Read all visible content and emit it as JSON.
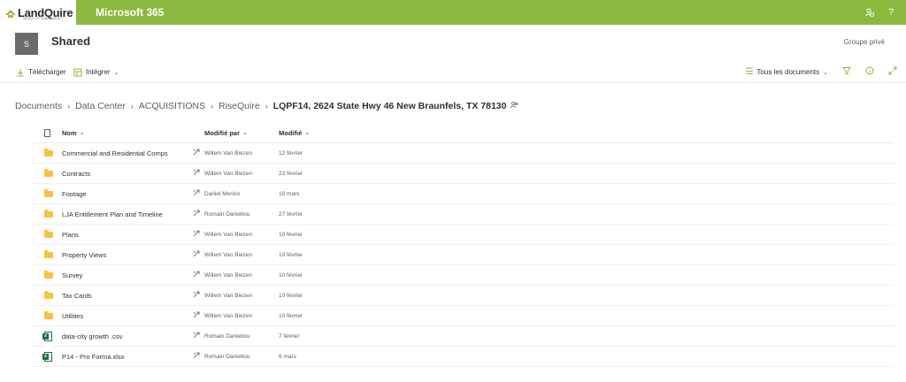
{
  "suitebar": {
    "logo_text": "LandQuire",
    "logo_tagline": "WORLD OF SUBDIVISION",
    "app_title": "Microsoft 365",
    "icons": [
      "people-settings-icon",
      "help-icon"
    ]
  },
  "site": {
    "avatar_letter": "S",
    "title": "Shared",
    "privacy": "Groupe privé"
  },
  "commands": {
    "download_label": "Télécharger",
    "integrate_label": "Intégrer",
    "view_label": "Tous les documents"
  },
  "breadcrumb": {
    "items": [
      "Documents",
      "Data Center",
      "ACQUISITIONS",
      "RiseQuire"
    ],
    "current": "LQPF14, 2624 State Hwy 46 New Braunfels, TX 78130"
  },
  "columns": {
    "name": "Nom",
    "modified_by": "Modifié par",
    "modified": "Modifié"
  },
  "files": [
    {
      "type": "folder",
      "name": "Commercial and Residential Comps",
      "modified_by": "Willem Van Biezen",
      "modified": "12 février"
    },
    {
      "type": "folder",
      "name": "Contracts",
      "modified_by": "Willem Van Biezen",
      "modified": "23 février"
    },
    {
      "type": "folder",
      "name": "Footage",
      "modified_by": "Daniel Merino",
      "modified": "10 mars"
    },
    {
      "type": "folder",
      "name": "LJA Entitlement Plan and Timeline",
      "modified_by": "Romain Daniellou",
      "modified": "27 février"
    },
    {
      "type": "folder",
      "name": "Plans",
      "modified_by": "Willem Van Biezen",
      "modified": "10 février"
    },
    {
      "type": "folder",
      "name": "Property Views",
      "modified_by": "Willem Van Biezen",
      "modified": "10 février"
    },
    {
      "type": "folder",
      "name": "Survey",
      "modified_by": "Willem Van Biezen",
      "modified": "10 février"
    },
    {
      "type": "folder",
      "name": "Tax Cards",
      "modified_by": "Willem Van Biezen",
      "modified": "10 février"
    },
    {
      "type": "folder",
      "name": "Utilities",
      "modified_by": "Willem Van Biezen",
      "modified": "10 février"
    },
    {
      "type": "excel",
      "name": "data-city growth .csv",
      "modified_by": "Romain Daniellou",
      "modified": "7 février"
    },
    {
      "type": "excel",
      "name": "P14 - Pro Forma.xlsx",
      "modified_by": "Romain Daniellou",
      "modified": "6 mars"
    }
  ],
  "colors": {
    "accent": "#8cb93f",
    "folder": "#f7c33c",
    "excel": "#1d6f42"
  }
}
